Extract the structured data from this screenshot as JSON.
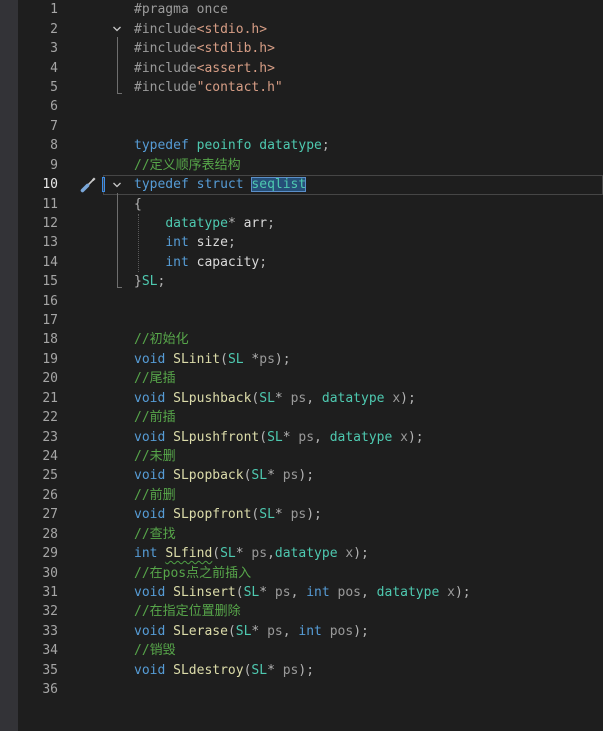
{
  "editor": {
    "theme": {
      "background": "#1e1e1e",
      "indicator_margin": "#333337",
      "line_number": "#a6a6a6",
      "current_line_number": "#e8e8e8",
      "current_line_border": "#464646",
      "selection": "#264f78",
      "selection_border": "#5b8fc9",
      "squiggle": "#4f9f45",
      "outline_line": "#6e6e6e",
      "indent_guide": "#5a5a5a",
      "caret_marker": "#3c8de6"
    },
    "lines": [
      {
        "n": 1,
        "tokens": [
          {
            "t": "#pragma once",
            "c": "#9b9b9b"
          }
        ]
      },
      {
        "n": 2,
        "fold_icon": "chevron-down-icon",
        "tokens": [
          {
            "t": "#include",
            "c": "#9b9b9b"
          },
          {
            "t": "<stdio.h>",
            "c": "#d69d85"
          }
        ]
      },
      {
        "n": 3,
        "tokens": [
          {
            "t": "#include",
            "c": "#9b9b9b"
          },
          {
            "t": "<stdlib.h>",
            "c": "#d69d85"
          }
        ]
      },
      {
        "n": 4,
        "tokens": [
          {
            "t": "#include",
            "c": "#9b9b9b"
          },
          {
            "t": "<assert.h>",
            "c": "#d69d85"
          }
        ]
      },
      {
        "n": 5,
        "tokens": [
          {
            "t": "#include",
            "c": "#9b9b9b"
          },
          {
            "t": "\"contact.h\"",
            "c": "#d69d85"
          }
        ]
      },
      {
        "n": 6,
        "tokens": []
      },
      {
        "n": 7,
        "tokens": []
      },
      {
        "n": 8,
        "tokens": [
          {
            "t": "typedef ",
            "c": "#569cd6"
          },
          {
            "t": "peoinfo ",
            "c": "#4ec9b0"
          },
          {
            "t": "datatype",
            "c": "#4ec9b0"
          },
          {
            "t": ";",
            "c": "#b4b4b4"
          }
        ]
      },
      {
        "n": 9,
        "tokens": [
          {
            "t": "//定义顺序表结构",
            "c": "#57a64a"
          }
        ]
      },
      {
        "n": 10,
        "current": true,
        "gutter_icon": "screwdriver-icon",
        "fold_icon": "chevron-down-icon",
        "tokens": [
          {
            "t": "typedef ",
            "c": "#569cd6"
          },
          {
            "t": "struct ",
            "c": "#569cd6"
          },
          {
            "t": "seqlist",
            "c": "#4ec9b0",
            "selected": true
          }
        ]
      },
      {
        "n": 11,
        "tokens": [
          {
            "t": "{",
            "c": "#b4b4b4"
          }
        ]
      },
      {
        "n": 12,
        "tokens": [
          {
            "t": "    ",
            "c": "#dadada"
          },
          {
            "t": "datatype",
            "c": "#4ec9b0"
          },
          {
            "t": "* ",
            "c": "#b4b4b4"
          },
          {
            "t": "arr",
            "c": "#dadada"
          },
          {
            "t": ";",
            "c": "#b4b4b4"
          }
        ]
      },
      {
        "n": 13,
        "tokens": [
          {
            "t": "    ",
            "c": "#dadada"
          },
          {
            "t": "int ",
            "c": "#569cd6"
          },
          {
            "t": "size",
            "c": "#dadada"
          },
          {
            "t": ";",
            "c": "#b4b4b4"
          }
        ]
      },
      {
        "n": 14,
        "tokens": [
          {
            "t": "    ",
            "c": "#dadada"
          },
          {
            "t": "int ",
            "c": "#569cd6"
          },
          {
            "t": "capacity",
            "c": "#dadada"
          },
          {
            "t": ";",
            "c": "#b4b4b4"
          }
        ]
      },
      {
        "n": 15,
        "tokens": [
          {
            "t": "}",
            "c": "#b4b4b4"
          },
          {
            "t": "SL",
            "c": "#4ec9b0"
          },
          {
            "t": ";",
            "c": "#b4b4b4"
          }
        ]
      },
      {
        "n": 16,
        "tokens": []
      },
      {
        "n": 17,
        "tokens": []
      },
      {
        "n": 18,
        "tokens": [
          {
            "t": "//初始化",
            "c": "#57a64a"
          }
        ]
      },
      {
        "n": 19,
        "tokens": [
          {
            "t": "void ",
            "c": "#569cd6"
          },
          {
            "t": "SLinit",
            "c": "#dcdcaa"
          },
          {
            "t": "(",
            "c": "#b4b4b4"
          },
          {
            "t": "SL ",
            "c": "#4ec9b0"
          },
          {
            "t": "*",
            "c": "#b4b4b4"
          },
          {
            "t": "ps",
            "c": "#9a9a9a"
          },
          {
            "t": ");",
            "c": "#b4b4b4"
          }
        ]
      },
      {
        "n": 20,
        "tokens": [
          {
            "t": "//尾插",
            "c": "#57a64a"
          }
        ]
      },
      {
        "n": 21,
        "tokens": [
          {
            "t": "void ",
            "c": "#569cd6"
          },
          {
            "t": "SLpushback",
            "c": "#dcdcaa"
          },
          {
            "t": "(",
            "c": "#b4b4b4"
          },
          {
            "t": "SL",
            "c": "#4ec9b0"
          },
          {
            "t": "* ",
            "c": "#b4b4b4"
          },
          {
            "t": "ps",
            "c": "#9a9a9a"
          },
          {
            "t": ", ",
            "c": "#b4b4b4"
          },
          {
            "t": "datatype ",
            "c": "#4ec9b0"
          },
          {
            "t": "x",
            "c": "#9a9a9a"
          },
          {
            "t": ");",
            "c": "#b4b4b4"
          }
        ]
      },
      {
        "n": 22,
        "tokens": [
          {
            "t": "//前插",
            "c": "#57a64a"
          }
        ]
      },
      {
        "n": 23,
        "tokens": [
          {
            "t": "void ",
            "c": "#569cd6"
          },
          {
            "t": "SLpushfront",
            "c": "#dcdcaa"
          },
          {
            "t": "(",
            "c": "#b4b4b4"
          },
          {
            "t": "SL",
            "c": "#4ec9b0"
          },
          {
            "t": "* ",
            "c": "#b4b4b4"
          },
          {
            "t": "ps",
            "c": "#9a9a9a"
          },
          {
            "t": ", ",
            "c": "#b4b4b4"
          },
          {
            "t": "datatype ",
            "c": "#4ec9b0"
          },
          {
            "t": "x",
            "c": "#9a9a9a"
          },
          {
            "t": ");",
            "c": "#b4b4b4"
          }
        ]
      },
      {
        "n": 24,
        "tokens": [
          {
            "t": "//未删",
            "c": "#57a64a"
          }
        ]
      },
      {
        "n": 25,
        "tokens": [
          {
            "t": "void ",
            "c": "#569cd6"
          },
          {
            "t": "SLpopback",
            "c": "#dcdcaa"
          },
          {
            "t": "(",
            "c": "#b4b4b4"
          },
          {
            "t": "SL",
            "c": "#4ec9b0"
          },
          {
            "t": "* ",
            "c": "#b4b4b4"
          },
          {
            "t": "ps",
            "c": "#9a9a9a"
          },
          {
            "t": ");",
            "c": "#b4b4b4"
          }
        ]
      },
      {
        "n": 26,
        "tokens": [
          {
            "t": "//前删",
            "c": "#57a64a"
          }
        ]
      },
      {
        "n": 27,
        "tokens": [
          {
            "t": "void ",
            "c": "#569cd6"
          },
          {
            "t": "SLpopfront",
            "c": "#dcdcaa"
          },
          {
            "t": "(",
            "c": "#b4b4b4"
          },
          {
            "t": "SL",
            "c": "#4ec9b0"
          },
          {
            "t": "* ",
            "c": "#b4b4b4"
          },
          {
            "t": "ps",
            "c": "#9a9a9a"
          },
          {
            "t": ");",
            "c": "#b4b4b4"
          }
        ]
      },
      {
        "n": 28,
        "tokens": [
          {
            "t": "//查找",
            "c": "#57a64a"
          }
        ]
      },
      {
        "n": 29,
        "tokens": [
          {
            "t": "int ",
            "c": "#569cd6"
          },
          {
            "t": "SLfind",
            "c": "#dcdcaa",
            "squiggle": true
          },
          {
            "t": "(",
            "c": "#b4b4b4"
          },
          {
            "t": "SL",
            "c": "#4ec9b0"
          },
          {
            "t": "* ",
            "c": "#b4b4b4"
          },
          {
            "t": "ps",
            "c": "#9a9a9a"
          },
          {
            "t": ",",
            "c": "#b4b4b4"
          },
          {
            "t": "datatype ",
            "c": "#4ec9b0"
          },
          {
            "t": "x",
            "c": "#9a9a9a"
          },
          {
            "t": ");",
            "c": "#b4b4b4"
          }
        ]
      },
      {
        "n": 30,
        "tokens": [
          {
            "t": "//在pos点之前插入",
            "c": "#57a64a"
          }
        ]
      },
      {
        "n": 31,
        "tokens": [
          {
            "t": "void ",
            "c": "#569cd6"
          },
          {
            "t": "SLinsert",
            "c": "#dcdcaa"
          },
          {
            "t": "(",
            "c": "#b4b4b4"
          },
          {
            "t": "SL",
            "c": "#4ec9b0"
          },
          {
            "t": "* ",
            "c": "#b4b4b4"
          },
          {
            "t": "ps",
            "c": "#9a9a9a"
          },
          {
            "t": ", ",
            "c": "#b4b4b4"
          },
          {
            "t": "int ",
            "c": "#569cd6"
          },
          {
            "t": "pos",
            "c": "#9a9a9a"
          },
          {
            "t": ", ",
            "c": "#b4b4b4"
          },
          {
            "t": "datatype ",
            "c": "#4ec9b0"
          },
          {
            "t": "x",
            "c": "#9a9a9a"
          },
          {
            "t": ");",
            "c": "#b4b4b4"
          }
        ]
      },
      {
        "n": 32,
        "tokens": [
          {
            "t": "//在指定位置删除",
            "c": "#57a64a"
          }
        ]
      },
      {
        "n": 33,
        "tokens": [
          {
            "t": "void ",
            "c": "#569cd6"
          },
          {
            "t": "SLerase",
            "c": "#dcdcaa"
          },
          {
            "t": "(",
            "c": "#b4b4b4"
          },
          {
            "t": "SL",
            "c": "#4ec9b0"
          },
          {
            "t": "* ",
            "c": "#b4b4b4"
          },
          {
            "t": "ps",
            "c": "#9a9a9a"
          },
          {
            "t": ", ",
            "c": "#b4b4b4"
          },
          {
            "t": "int ",
            "c": "#569cd6"
          },
          {
            "t": "pos",
            "c": "#9a9a9a"
          },
          {
            "t": ");",
            "c": "#b4b4b4"
          }
        ]
      },
      {
        "n": 34,
        "tokens": [
          {
            "t": "//销毁",
            "c": "#57a64a"
          }
        ]
      },
      {
        "n": 35,
        "tokens": [
          {
            "t": "void ",
            "c": "#569cd6"
          },
          {
            "t": "SLdestroy",
            "c": "#dcdcaa"
          },
          {
            "t": "(",
            "c": "#b4b4b4"
          },
          {
            "t": "SL",
            "c": "#4ec9b0"
          },
          {
            "t": "* ",
            "c": "#b4b4b4"
          },
          {
            "t": "ps",
            "c": "#9a9a9a"
          },
          {
            "t": ");",
            "c": "#b4b4b4"
          }
        ]
      },
      {
        "n": 36,
        "tokens": []
      }
    ]
  }
}
